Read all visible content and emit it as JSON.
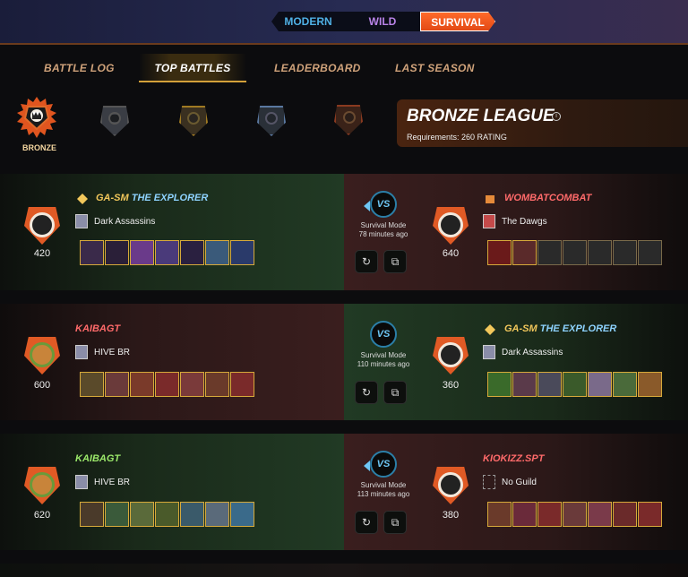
{
  "mode_tabs": [
    {
      "label": "MODERN",
      "active": false
    },
    {
      "label": "WILD",
      "active": false
    },
    {
      "label": "SURVIVAL",
      "active": true
    }
  ],
  "nav_tabs": [
    {
      "label": "BATTLE LOG",
      "active": false
    },
    {
      "label": "TOP BATTLES",
      "active": true
    },
    {
      "label": "LEADERBOARD",
      "active": false
    },
    {
      "label": "LAST SEASON",
      "active": false
    }
  ],
  "leagues": {
    "selected_label": "BRONZE",
    "items": [
      "bronze",
      "silver",
      "gold",
      "diamond",
      "champion"
    ]
  },
  "league_card": {
    "title": "BRONZE LEAGUE",
    "info_icon": "i",
    "requirements": "Requirements: 260 RATING"
  },
  "battles": [
    {
      "vs": "VS",
      "mode": "Survival Mode",
      "time": "78 minutes ago",
      "left": {
        "winner": true,
        "name_prefix": "GA-SM",
        "name_rest": "THE EXPLORER",
        "guild": "Dark Assassins",
        "rating": "420",
        "cards": 7,
        "empty_cards": 0
      },
      "right": {
        "winner": false,
        "name": "WOMBATCOMBAT",
        "guild": "The Dawgs",
        "rating": "640",
        "cards": 2,
        "empty_cards": 5
      }
    },
    {
      "vs": "VS",
      "mode": "Survival Mode",
      "time": "110 minutes ago",
      "left": {
        "winner": false,
        "name": "KAIBAGT",
        "guild": "HIVE BR",
        "rating": "600",
        "cards": 7,
        "empty_cards": 0
      },
      "right": {
        "winner": true,
        "name_prefix": "GA-SM",
        "name_rest": "THE EXPLORER",
        "guild": "Dark Assassins",
        "rating": "360",
        "cards": 7,
        "empty_cards": 0
      }
    },
    {
      "vs": "VS",
      "mode": "Survival Mode",
      "time": "113 minutes ago",
      "left": {
        "winner": true,
        "name": "KAIBAGT",
        "guild": "HIVE BR",
        "rating": "620",
        "cards": 7,
        "empty_cards": 0
      },
      "right": {
        "winner": false,
        "name": "KIOKIZZ.SPT",
        "guild": "No Guild",
        "rating": "380",
        "cards": 7,
        "empty_cards": 0
      }
    }
  ],
  "colors": {
    "accent_orange": "#e05a25",
    "winner_name": "#9be86a",
    "loser_name": "#ff6a6a",
    "gold_name": "#f2c75b",
    "title_name": "#8ed3ff",
    "vs_blue": "#6ec7f5"
  }
}
